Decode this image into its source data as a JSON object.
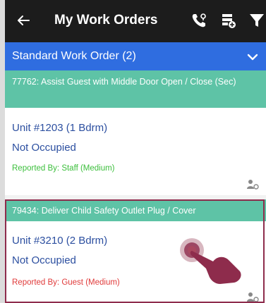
{
  "header": {
    "title": "My Work Orders",
    "icons": [
      "back-arrow-icon",
      "phone-call-icon",
      "add-list-icon",
      "filter-icon"
    ]
  },
  "section": {
    "title": "Standard Work Order (2)",
    "expanded": true
  },
  "work_orders": [
    {
      "heading": "77762: Assist Guest with Middle Door Open / Close (Sec)",
      "unit": "Unit #1203 (1 Bdrm)",
      "occupancy": "Not Occupied",
      "reported_by": "Reported By: Staff (Medium)",
      "reported_color": "#3cbf3c"
    },
    {
      "heading": "79434: Deliver Child Safety Outlet Plug / Cover",
      "unit": "Unit #3210 (2 Bdrm)",
      "occupancy": "Not Occupied",
      "reported_by": "Reported By: Guest (Medium)",
      "reported_color": "#e03a3a"
    }
  ],
  "colors": {
    "topbar": "#1c1c1c",
    "section": "#2f6de0",
    "wo_header": "#5ec3a6",
    "highlight": "#8e2c4c"
  }
}
